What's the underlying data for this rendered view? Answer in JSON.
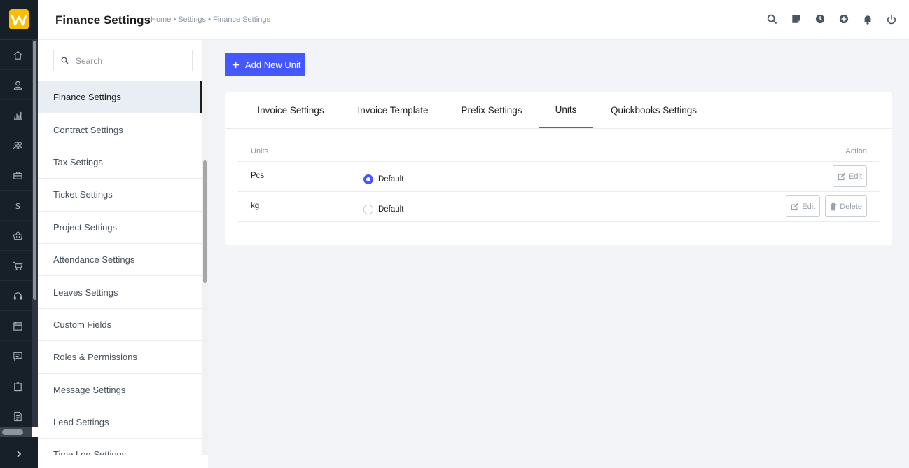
{
  "header": {
    "title": "Finance Settings",
    "breadcrumb": "Home • Settings • Finance Settings",
    "icons": [
      "search-icon",
      "sticky-note-icon",
      "clock-icon",
      "plus-circle-icon",
      "bell-icon",
      "power-icon"
    ]
  },
  "rail": {
    "logo_letter": "W",
    "icons": [
      "home-icon",
      "user-icon",
      "chart-icon",
      "users-icon",
      "briefcase-icon",
      "dollar-icon",
      "basket-icon",
      "cart-icon",
      "headset-icon",
      "calendar-icon",
      "chat-icon",
      "clipboard-icon",
      "document-icon"
    ]
  },
  "settings_nav": {
    "search_placeholder": "Search",
    "items": [
      "Finance Settings",
      "Contract Settings",
      "Tax Settings",
      "Ticket Settings",
      "Project Settings",
      "Attendance Settings",
      "Leaves Settings",
      "Custom Fields",
      "Roles & Permissions",
      "Message Settings",
      "Lead Settings",
      "Time Log Settings"
    ],
    "active_item": "Finance Settings"
  },
  "main": {
    "add_button_label": "Add New Unit",
    "tabs": [
      "Invoice Settings",
      "Invoice Template",
      "Prefix Settings",
      "Units",
      "Quickbooks Settings"
    ],
    "active_tab": "Units",
    "table": {
      "col_units": "Units",
      "col_action": "Action",
      "rows": [
        {
          "name": "Pcs",
          "default_label": "Default",
          "is_default": true,
          "edit_label": "Edit"
        },
        {
          "name": "kg",
          "default_label": "Default",
          "is_default": false,
          "edit_label": "Edit",
          "delete_label": "Delete"
        }
      ]
    }
  },
  "colors": {
    "rail_bg": "#171f29",
    "logo_bg": "#fcbd01",
    "accent": "#4557ff",
    "page_bg": "#f2f4f7"
  }
}
